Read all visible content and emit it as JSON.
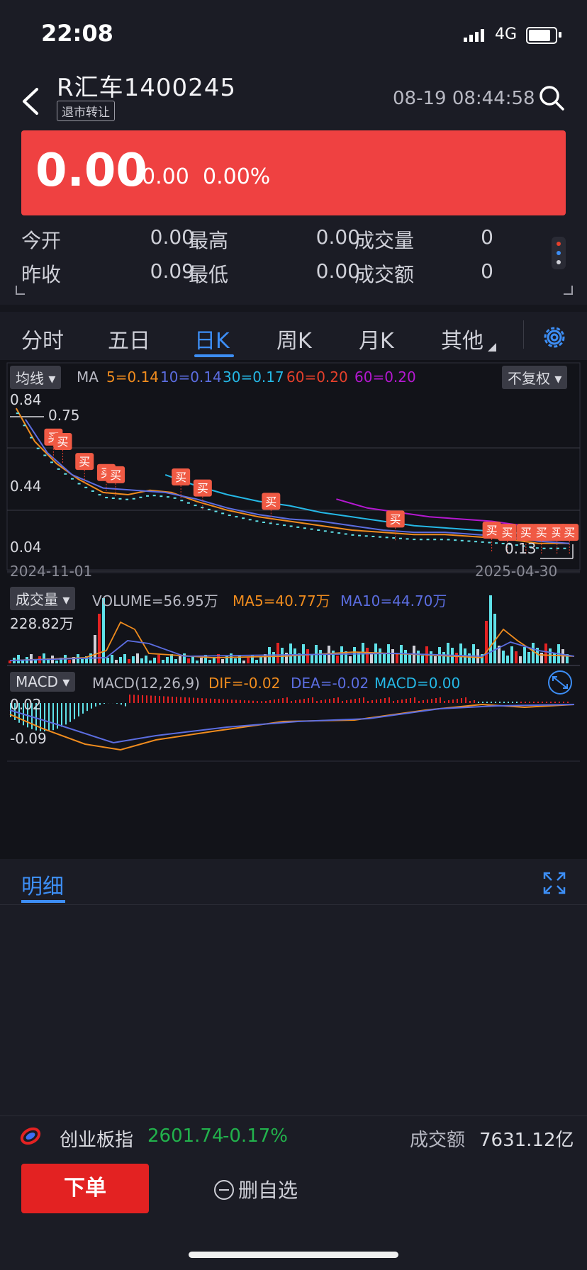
{
  "status": {
    "time": "22:08",
    "network": "4G"
  },
  "header": {
    "stock_title": "R汇车1400245",
    "tag": "退市转让",
    "timestamp": "08-19 08:44:58"
  },
  "quote": {
    "price": "0.00",
    "change": "0.00",
    "pct": "0.00%",
    "color": "#ef4141"
  },
  "stats": {
    "open_label": "今开",
    "open": "0.00",
    "high_label": "最高",
    "high": "0.00",
    "vol_label": "成交量",
    "vol": "0",
    "prev_label": "昨收",
    "prev": "0.09",
    "low_label": "最低",
    "low": "0.00",
    "amt_label": "成交额",
    "amt": "0"
  },
  "tabs": [
    "分时",
    "五日",
    "日K",
    "周K",
    "月K",
    "其他"
  ],
  "active_tab": "日K",
  "kline": {
    "ma_dropdown": "均线",
    "ma_prefix": "MA",
    "ma5": "5=0.14",
    "ma10": "10=0.14",
    "ma30": "30=0.17",
    "ma60a": "60=0.20",
    "ma60b": "60=0.20",
    "adjust": "不复权",
    "y_top": "0.84",
    "y_mid": "0.44",
    "y_low": "0.04",
    "max_mark": "0.75",
    "min_mark": "0.13",
    "date_start": "2024-11-01",
    "date_end": "2025-04-30",
    "buy_label": "买"
  },
  "volume": {
    "dropdown": "成交量",
    "text": "VOLUME=56.95万",
    "ma5": "MA5=40.77万",
    "ma10": "MA10=44.70万",
    "y_top": "228.82万"
  },
  "macd": {
    "dropdown": "MACD",
    "params": "MACD(12,26,9)",
    "dif": "DIF=-0.02",
    "dea": "DEA=-0.02",
    "macd": "MACD=0.00",
    "y_top": "0.02",
    "y_low": "-0.09"
  },
  "detail": {
    "tab": "明细"
  },
  "index": {
    "name": "创业板指",
    "value": "2601.74",
    "change": "-0.17%",
    "amt_label": "成交额",
    "amt": "7631.12亿"
  },
  "actions": {
    "order": "下单",
    "remove": "删自选"
  },
  "colors": {
    "ma5": "#f08c1e",
    "ma10": "#5b6de0",
    "ma30": "#25b8e6",
    "ma60a": "#e6402b",
    "ma60b": "#b418d0",
    "up": "#e32222",
    "down": "#5fe1e8"
  },
  "chart_data": {
    "type": "line",
    "title": "",
    "x_range": [
      "2024-11-01",
      "2025-04-30"
    ],
    "ylim": [
      0.04,
      0.84
    ],
    "series": [
      {
        "name": "MA5",
        "x": [
          2,
          8,
          15,
          22,
          30,
          38,
          45,
          52,
          60,
          70,
          80,
          90,
          100,
          110,
          120,
          130,
          140,
          150,
          160,
          165,
          170,
          175,
          180
        ],
        "values": [
          0.75,
          0.6,
          0.5,
          0.43,
          0.37,
          0.36,
          0.38,
          0.37,
          0.33,
          0.29,
          0.26,
          0.24,
          0.22,
          0.2,
          0.19,
          0.18,
          0.18,
          0.17,
          0.16,
          0.15,
          0.14,
          0.14,
          0.14
        ]
      },
      {
        "name": "MA10",
        "x": [
          5,
          12,
          20,
          30,
          40,
          50,
          60,
          70,
          80,
          90,
          100,
          110,
          120,
          130,
          140,
          150,
          160,
          170,
          180
        ],
        "values": [
          0.7,
          0.55,
          0.45,
          0.39,
          0.38,
          0.37,
          0.34,
          0.3,
          0.27,
          0.25,
          0.24,
          0.22,
          0.2,
          0.19,
          0.19,
          0.18,
          0.17,
          0.15,
          0.14
        ]
      },
      {
        "name": "MA30",
        "x": [
          50,
          60,
          70,
          80,
          90,
          100,
          110,
          120,
          130,
          140,
          150,
          160,
          170,
          180
        ],
        "values": [
          0.45,
          0.4,
          0.36,
          0.33,
          0.31,
          0.28,
          0.26,
          0.24,
          0.22,
          0.21,
          0.2,
          0.19,
          0.18,
          0.17
        ]
      },
      {
        "name": "MA60",
        "x": [
          105,
          115,
          125,
          135,
          145,
          155,
          165,
          175,
          180
        ],
        "values": [
          0.34,
          0.3,
          0.28,
          0.26,
          0.25,
          0.24,
          0.22,
          0.21,
          0.2
        ]
      }
    ]
  }
}
